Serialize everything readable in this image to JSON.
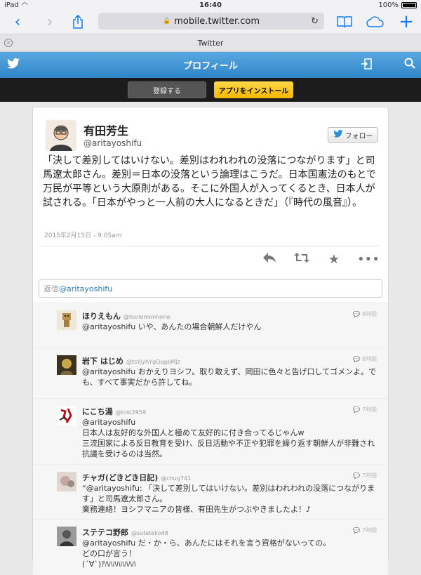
{
  "status": {
    "device": "iPad",
    "time": "16:40",
    "battery": "100%"
  },
  "browser": {
    "url": "mobile.twitter.com",
    "tab_title": "Twitter"
  },
  "header": {
    "title": "プロフィール"
  },
  "promo": {
    "register": "登録する",
    "install": "アプリをインストール"
  },
  "profile": {
    "name": "有田芳生",
    "handle": "@aritayoshifu",
    "follow": "フォロー"
  },
  "tweet": {
    "text": "「決して差別してはいけない。差別はわれわれの没落につながります」と司馬遼太郎さん。差別＝日本の没落という論理はこうだ。日本国憲法のもとで万民が平等という大原則がある。そこに外国人が入ってくるとき、日本人が試される。「日本がやっと一人前の大人になるときだ」（『時代の風音』）。",
    "date": "2015年2月15日 - 9:05am"
  },
  "reply_box": {
    "prefix": "返信",
    "mention": "@aritayoshifu"
  },
  "replies": [
    {
      "name": "ほりえもん",
      "handle": "@horiemonhorie",
      "time": "8時間",
      "lines": [
        "@aritayoshifu いや、あんたの場合朝鮮人だけやん"
      ]
    },
    {
      "name": "岩下 はじめ",
      "handle": "@tsYjyhYgQqgbMjz",
      "time": "8時間",
      "lines": [
        "@aritayoshifu おかえりヨシフ。取り敢えず、岡田に色々と告げ口してゴメンよ。でも、すべて事実だから許してね。"
      ]
    },
    {
      "name": "にこち湯",
      "handle": "@toki2959",
      "time": "7時間",
      "lines": [
        "@aritayoshifu",
        "日本人は友好的な外国人と極めて友好的に付き合ってるじゃんw",
        "三流国家による反日教育を受け、反日活動や不正や犯罪を繰り返す朝鮮人が非難され抗議を受けるのは当然。"
      ]
    },
    {
      "name": "チャガ(どきどき日記)",
      "handle": "@chug741",
      "time": "7時間",
      "lines": [
        "“@aritayoshifu: 「決して差別してはいけない。差別はわれわれの没落につながります」と司馬遼太郎さん。",
        "業務連絡！ヨシフマニアの皆様、有田先生がつぶやきましたよ！♪"
      ]
    },
    {
      "name": "ステテコ野郎",
      "handle": "@suteteko48",
      "time": "7時間",
      "lines": [
        "@aritayoshifu だ・か・ら、あんたにはそれを言う資格がないっての。",
        "どの口が言う！",
        "(´∀`)ｱﾊﾊﾊﾊﾊﾊﾊﾊ"
      ]
    }
  ]
}
